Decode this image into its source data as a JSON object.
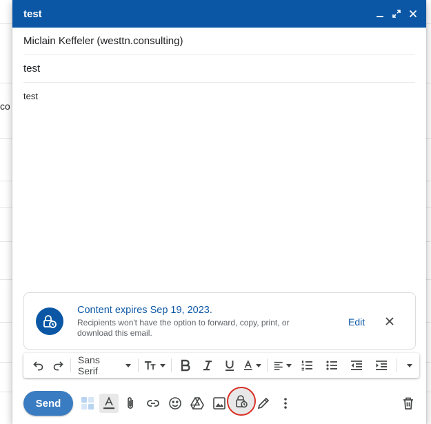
{
  "background": {
    "fragment_text": "co"
  },
  "compose": {
    "title": "test",
    "to_value": "Miclain Keffeler (westtn.consulting)",
    "subject_value": "test",
    "body_text": "test"
  },
  "confidential_banner": {
    "title": "Content expires Sep 19, 2023.",
    "description": "Recipients won't have the option to forward, copy, print, or download this email.",
    "edit_label": "Edit"
  },
  "format_bar": {
    "font_family": "Sans Serif"
  },
  "bottom_bar": {
    "send_label": "Send"
  },
  "colors": {
    "header": "#0b57a5",
    "send": "#3a7cc2",
    "highlight": "#d93025"
  }
}
